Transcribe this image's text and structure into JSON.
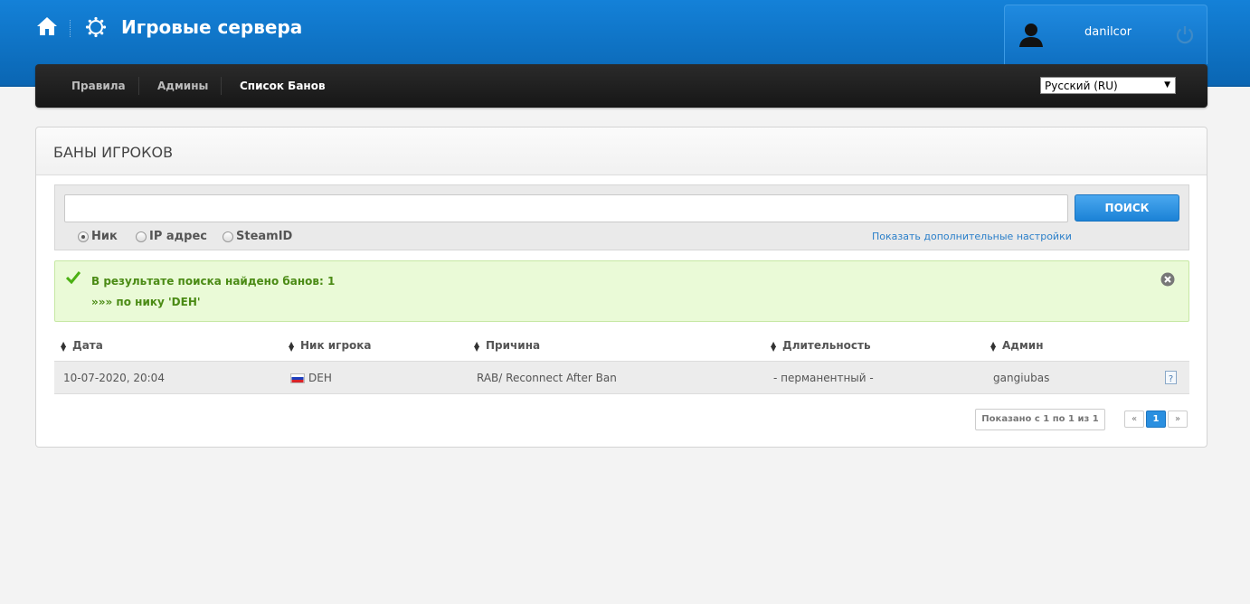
{
  "header": {
    "site_title": "Игровые сервера",
    "username": "danilcor"
  },
  "nav": {
    "items": [
      {
        "label": "Правила",
        "active": false
      },
      {
        "label": "Админы",
        "active": false
      },
      {
        "label": "Список Банов",
        "active": true
      }
    ],
    "language": "Русский (RU)"
  },
  "panel": {
    "title": "БАНЫ ИГРОКОВ",
    "search": {
      "value": "",
      "button": "ПОИСК",
      "options": [
        {
          "label": "Ник",
          "checked": true
        },
        {
          "label": "IP адрес",
          "checked": false
        },
        {
          "label": "SteamID",
          "checked": false
        }
      ],
      "advanced_link": "Показать дополнительные настройки"
    },
    "alert": {
      "line1": "В результате поиска найдено банов: 1",
      "line2": "»»» по нику 'DEH'"
    },
    "table": {
      "headers": [
        "Дата",
        "Ник игрока",
        "Причина",
        "Длительность",
        "Админ"
      ],
      "rows": [
        {
          "date": "10-07-2020, 20:04",
          "nick": "DEH",
          "reason": "RAB/ Reconnect After Ban",
          "duration": "- перманентный -",
          "admin": "gangiubas"
        }
      ]
    },
    "pagination": {
      "info": "Показано с 1 по 1 из 1",
      "prev": "«",
      "current": "1",
      "next": "»"
    }
  },
  "colors": {
    "header_blue": "#0a66b3",
    "accent_blue": "#1b82d6",
    "success_text": "#4b8b15",
    "success_bg": "#eafad7"
  }
}
